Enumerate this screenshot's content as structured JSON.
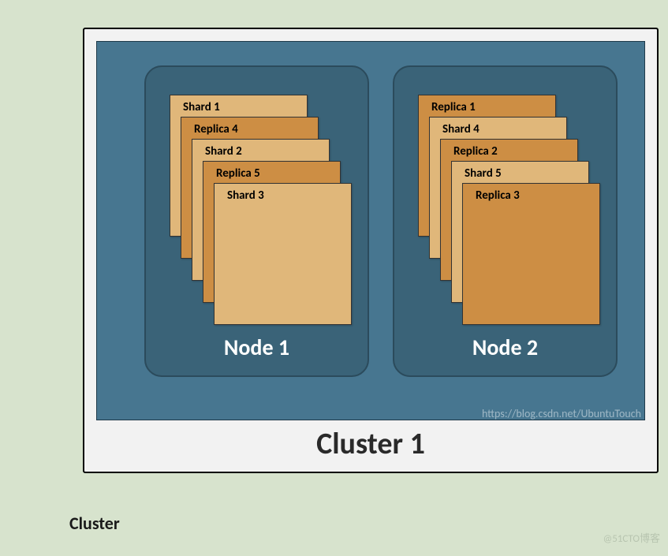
{
  "caption": "Cluster",
  "cluster_label": "Cluster 1",
  "url_watermark": "https://blog.csdn.net/UbuntuTouch",
  "blog_watermark": "@51CTO博客",
  "nodes": [
    {
      "label": "Node 1",
      "cards": [
        {
          "label": "Shard 1",
          "type": "shard"
        },
        {
          "label": "Replica 4",
          "type": "replica"
        },
        {
          "label": "Shard 2",
          "type": "shard"
        },
        {
          "label": "Replica 5",
          "type": "replica"
        },
        {
          "label": "Shard 3",
          "type": "shard"
        }
      ]
    },
    {
      "label": "Node 2",
      "cards": [
        {
          "label": "Replica 1",
          "type": "replica"
        },
        {
          "label": "Shard 4",
          "type": "shard"
        },
        {
          "label": "Replica 2",
          "type": "replica"
        },
        {
          "label": "Shard 5",
          "type": "shard"
        },
        {
          "label": "Replica 3",
          "type": "replica"
        }
      ]
    }
  ]
}
